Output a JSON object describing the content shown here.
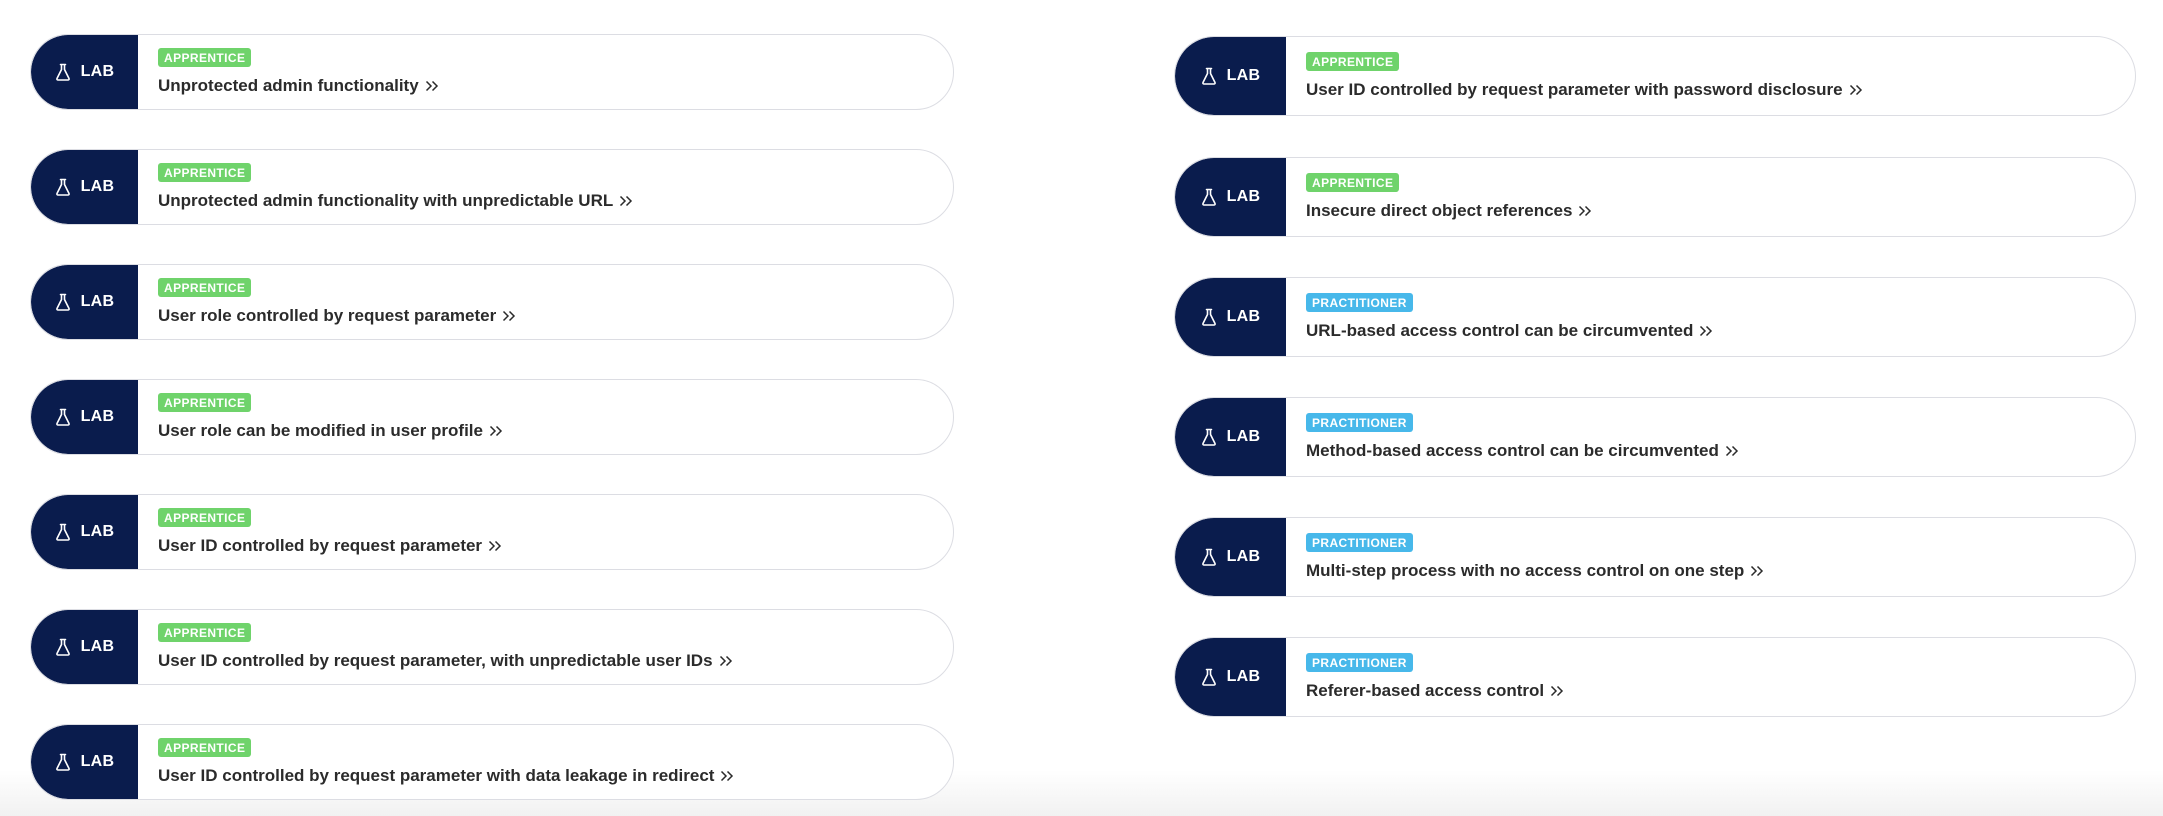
{
  "badge_label": "LAB",
  "icons": {
    "flask": "flask-icon",
    "chevron": "double-chevron-right-icon"
  },
  "colors": {
    "badge_bg": "#0a1c4d",
    "apprentice": "#6fd36b",
    "practitioner": "#47b8ea",
    "card_border": "#dcdde3",
    "title_text": "#2b2b2b"
  },
  "left_labs": [
    {
      "level": "APPRENTICE",
      "title": "Unprotected admin functionality"
    },
    {
      "level": "APPRENTICE",
      "title": "Unprotected admin functionality with unpredictable URL"
    },
    {
      "level": "APPRENTICE",
      "title": "User role controlled by request parameter"
    },
    {
      "level": "APPRENTICE",
      "title": "User role can be modified in user profile"
    },
    {
      "level": "APPRENTICE",
      "title": "User ID controlled by request parameter"
    },
    {
      "level": "APPRENTICE",
      "title": "User ID controlled by request parameter, with unpredictable user IDs"
    },
    {
      "level": "APPRENTICE",
      "title": "User ID controlled by request parameter with data leakage in redirect"
    }
  ],
  "right_labs": [
    {
      "level": "APPRENTICE",
      "title": "User ID controlled by request parameter with password disclosure"
    },
    {
      "level": "APPRENTICE",
      "title": "Insecure direct object references"
    },
    {
      "level": "PRACTITIONER",
      "title": "URL-based access control can be circumvented"
    },
    {
      "level": "PRACTITIONER",
      "title": "Method-based access control can be circumvented"
    },
    {
      "level": "PRACTITIONER",
      "title": "Multi-step process with no access control on one step"
    },
    {
      "level": "PRACTITIONER",
      "title": "Referer-based access control"
    }
  ]
}
